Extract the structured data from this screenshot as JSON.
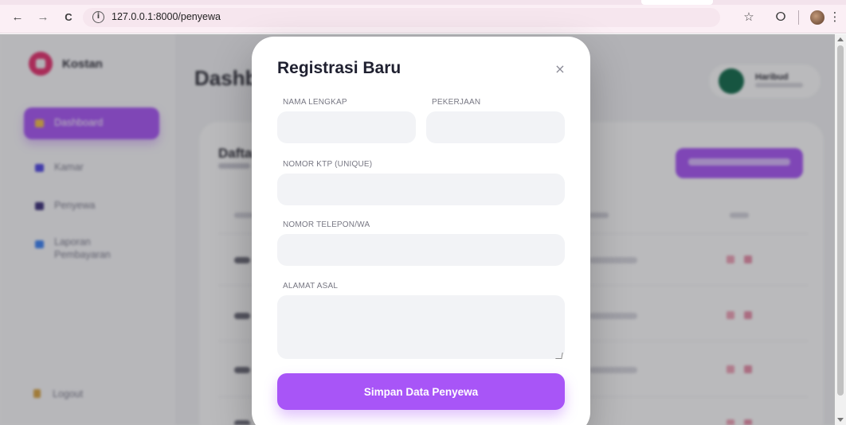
{
  "browser": {
    "nav_back": "←",
    "nav_forward": "→",
    "nav_reload": "C",
    "url": "127.0.0.1:8000/penyewa",
    "bookmark_icon": "☆",
    "extensions_icon": "ⵔ",
    "menu_icon": "⋮"
  },
  "app": {
    "brand": "Kostan",
    "heading": "Dashboard",
    "sidebar_items": [
      {
        "label": "Dashboard",
        "active": true
      },
      {
        "label": "Kamar"
      },
      {
        "label": "Penyewa"
      },
      {
        "label": "Laporan",
        "label2": "Pembayaran"
      }
    ],
    "logout": "Logout",
    "user_name": "Haribud",
    "card_title": "Daftar"
  },
  "modal": {
    "title": "Registrasi Baru",
    "close": "×",
    "fields": {
      "nama_label": "NAMA LENGKAP",
      "nama_value": "",
      "pekerjaan_label": "PEKERJAAN",
      "pekerjaan_value": "",
      "ktp_label": "NOMOR KTP (UNIQUE)",
      "ktp_value": "",
      "telepon_label": "NOMOR TELEPON/WA",
      "telepon_value": "",
      "alamat_label": "ALAMAT ASAL",
      "alamat_value": ""
    },
    "submit_label": "Simpan Data Penyewa"
  },
  "colors": {
    "accent": "#a855f7",
    "field_bg": "#f2f3f6",
    "brand_logo": "#e6306e",
    "avatar": "#0f6b4a"
  }
}
